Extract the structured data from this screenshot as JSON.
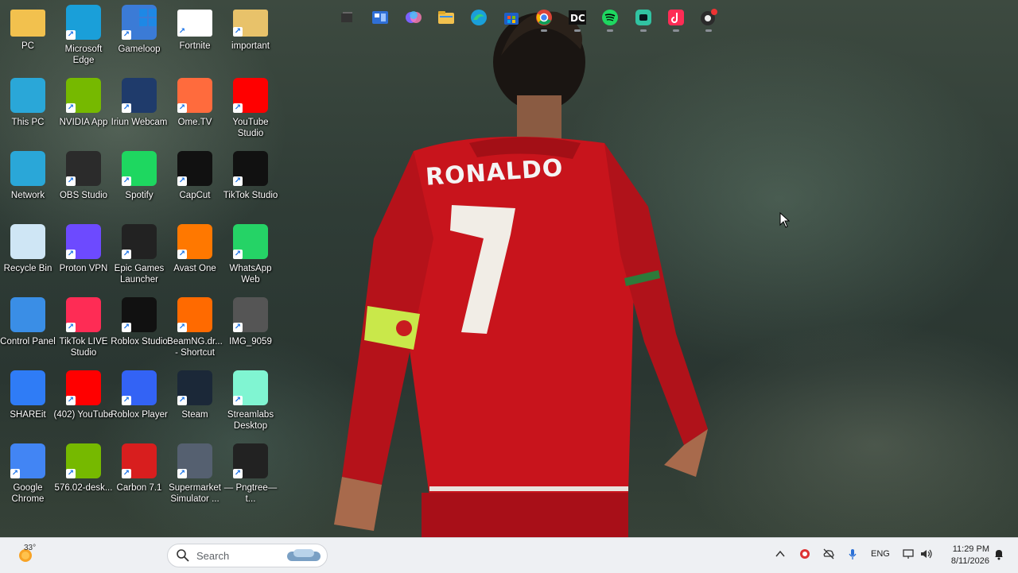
{
  "wallpaper": {
    "jersey_name": "RONALDO",
    "jersey_number": "7"
  },
  "desktop_icons": [
    {
      "label": "PC",
      "icon": "folder-icon",
      "color": "#f2c14e"
    },
    {
      "label": "Microsoft Edge",
      "icon": "edge-icon",
      "color": "#1a9fd9"
    },
    {
      "label": "Gameloop",
      "icon": "gameloop-icon",
      "color": "#3b7bd6"
    },
    {
      "label": "Fortnite",
      "icon": "file-icon",
      "color": "#ffffff"
    },
    {
      "label": "important",
      "icon": "folder-icon",
      "color": "#e8c26a"
    },
    {
      "label": "This PC",
      "icon": "monitor-icon",
      "color": "#2aa7d8"
    },
    {
      "label": "NVIDIA App",
      "icon": "nvidia-icon",
      "color": "#76b900"
    },
    {
      "label": "Iriun Webcam",
      "icon": "webcam-icon",
      "color": "#1f3b6b"
    },
    {
      "label": "Ome.TV",
      "icon": "tv-icon",
      "color": "#ff6b3d"
    },
    {
      "label": "YouTube Studio",
      "icon": "youtube-studio-icon",
      "color": "#ff0000"
    },
    {
      "label": "Network",
      "icon": "network-icon",
      "color": "#2aa7d8"
    },
    {
      "label": "OBS Studio",
      "icon": "obs-icon",
      "color": "#2b2b2b"
    },
    {
      "label": "Spotify",
      "icon": "spotify-icon",
      "color": "#1ed760"
    },
    {
      "label": "CapCut",
      "icon": "capcut-icon",
      "color": "#111111"
    },
    {
      "label": "TikTok Studio",
      "icon": "tiktok-icon",
      "color": "#111111"
    },
    {
      "label": "Recycle Bin",
      "icon": "recycle-bin-icon",
      "color": "#cfe6f5"
    },
    {
      "label": "Proton VPN",
      "icon": "proton-vpn-icon",
      "color": "#6d4aff"
    },
    {
      "label": "Epic Games Launcher",
      "icon": "epic-games-icon",
      "color": "#222222"
    },
    {
      "label": "Avast One",
      "icon": "avast-icon",
      "color": "#ff7800"
    },
    {
      "label": "WhatsApp Web",
      "icon": "whatsapp-icon",
      "color": "#25d366"
    },
    {
      "label": "Control Panel",
      "icon": "control-panel-icon",
      "color": "#3a8ee6"
    },
    {
      "label": "TikTok LIVE Studio",
      "icon": "tiktok-live-icon",
      "color": "#fe2c55"
    },
    {
      "label": "Roblox Studio",
      "icon": "roblox-studio-icon",
      "color": "#111111"
    },
    {
      "label": "BeamNG.dr... - Shortcut",
      "icon": "beamng-icon",
      "color": "#ff6a00"
    },
    {
      "label": "IMG_9059",
      "icon": "video-thumbnail-icon",
      "color": "#555555"
    },
    {
      "label": "SHAREit",
      "icon": "shareit-icon",
      "color": "#2f7cf6"
    },
    {
      "label": "(402) YouTube",
      "icon": "youtube-icon",
      "color": "#ff0000"
    },
    {
      "label": "Roblox Player",
      "icon": "roblox-icon",
      "color": "#3363f5"
    },
    {
      "label": "Steam",
      "icon": "steam-icon",
      "color": "#1b2838"
    },
    {
      "label": "Streamlabs Desktop",
      "icon": "streamlabs-icon",
      "color": "#80f5d2"
    },
    {
      "label": "Google Chrome",
      "icon": "chrome-icon",
      "color": "#4285f4"
    },
    {
      "label": "576.02-desk...",
      "icon": "nvidia-installer-icon",
      "color": "#76b900"
    },
    {
      "label": "Carbon 7.1",
      "icon": "carbon-icon",
      "color": "#d81e1e"
    },
    {
      "label": "Supermarket Simulator ...",
      "icon": "supermarket-icon",
      "color": "#556070"
    },
    {
      "label": "— Pngtree—t...",
      "icon": "image-file-icon",
      "color": "#222222"
    }
  ],
  "taskbar": {
    "weather_temp": "33°",
    "search_placeholder": "Search",
    "language": "ENG",
    "time": "11:29 PM",
    "date": "8/11/2026",
    "apps": [
      "start-icon",
      "search-icon",
      "task-view-icon",
      "widgets-icon",
      "copilot-icon",
      "file-explorer-icon",
      "edge-icon",
      "store-icon",
      "chrome-icon",
      "dc-app-icon",
      "spotify-icon",
      "streamlabs-icon",
      "tiktok-live-icon",
      "obs-icon"
    ]
  }
}
